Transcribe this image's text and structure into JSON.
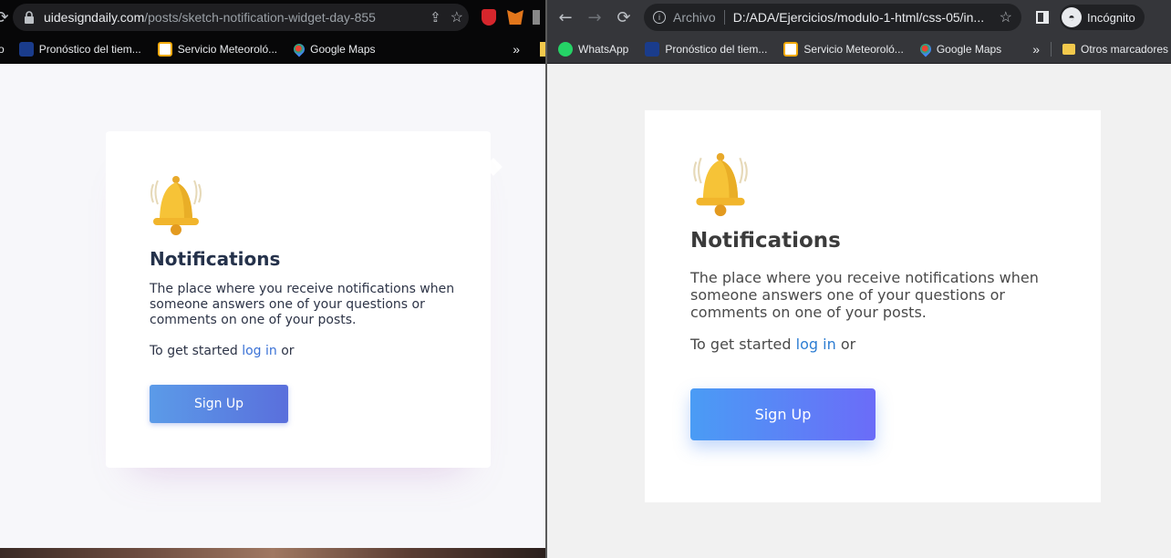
{
  "left_browser": {
    "url_domain": "uidesigndaily.com",
    "url_path": "/posts/sketch-notification-widget-day-855",
    "bookmarks": [
      {
        "label": "Pronóstico del tiem...",
        "icon": "weather-channel-icon"
      },
      {
        "label": "Servicio Meteoroló...",
        "icon": "meteo-service-icon"
      },
      {
        "label": "Google Maps",
        "icon": "google-maps-icon"
      }
    ],
    "more_bookmarks": "»"
  },
  "right_browser": {
    "url_prefix": "Archivo",
    "url_path": "D:/ADA/Ejercicios/modulo-1-html/css-05/in...",
    "profile_label": "Incógnito",
    "bookmarks": [
      {
        "label": "WhatsApp",
        "icon": "whatsapp-icon"
      },
      {
        "label": "Pronóstico del tiem...",
        "icon": "weather-channel-icon"
      },
      {
        "label": "Servicio Meteoroló...",
        "icon": "meteo-service-icon"
      },
      {
        "label": "Google Maps",
        "icon": "google-maps-icon"
      }
    ],
    "more_bookmarks": "»",
    "other_bookmarks": "Otros marcadores"
  },
  "card_left": {
    "title": "Notifications",
    "description": "The place where you receive notifications when someone answers one of your questions or comments on one of your posts.",
    "started_prefix": "To get started",
    "login_link": "log in",
    "started_suffix": "or",
    "button": "Sign Up"
  },
  "card_right": {
    "title": "Notifications",
    "description": "The place where you receive notifications when someone answers one of your questions or comments on one of your posts.",
    "started_prefix": "To get started",
    "login_link": "log in",
    "started_suffix": "or",
    "button": "Sign Up"
  },
  "colors": {
    "button_gradient_left": [
      "#5b9be8",
      "#5a6fdc"
    ],
    "button_gradient_right": [
      "#4a9cf5",
      "#6b6cf8"
    ],
    "link": "#3b72d6",
    "bell": "#f5c33b"
  }
}
